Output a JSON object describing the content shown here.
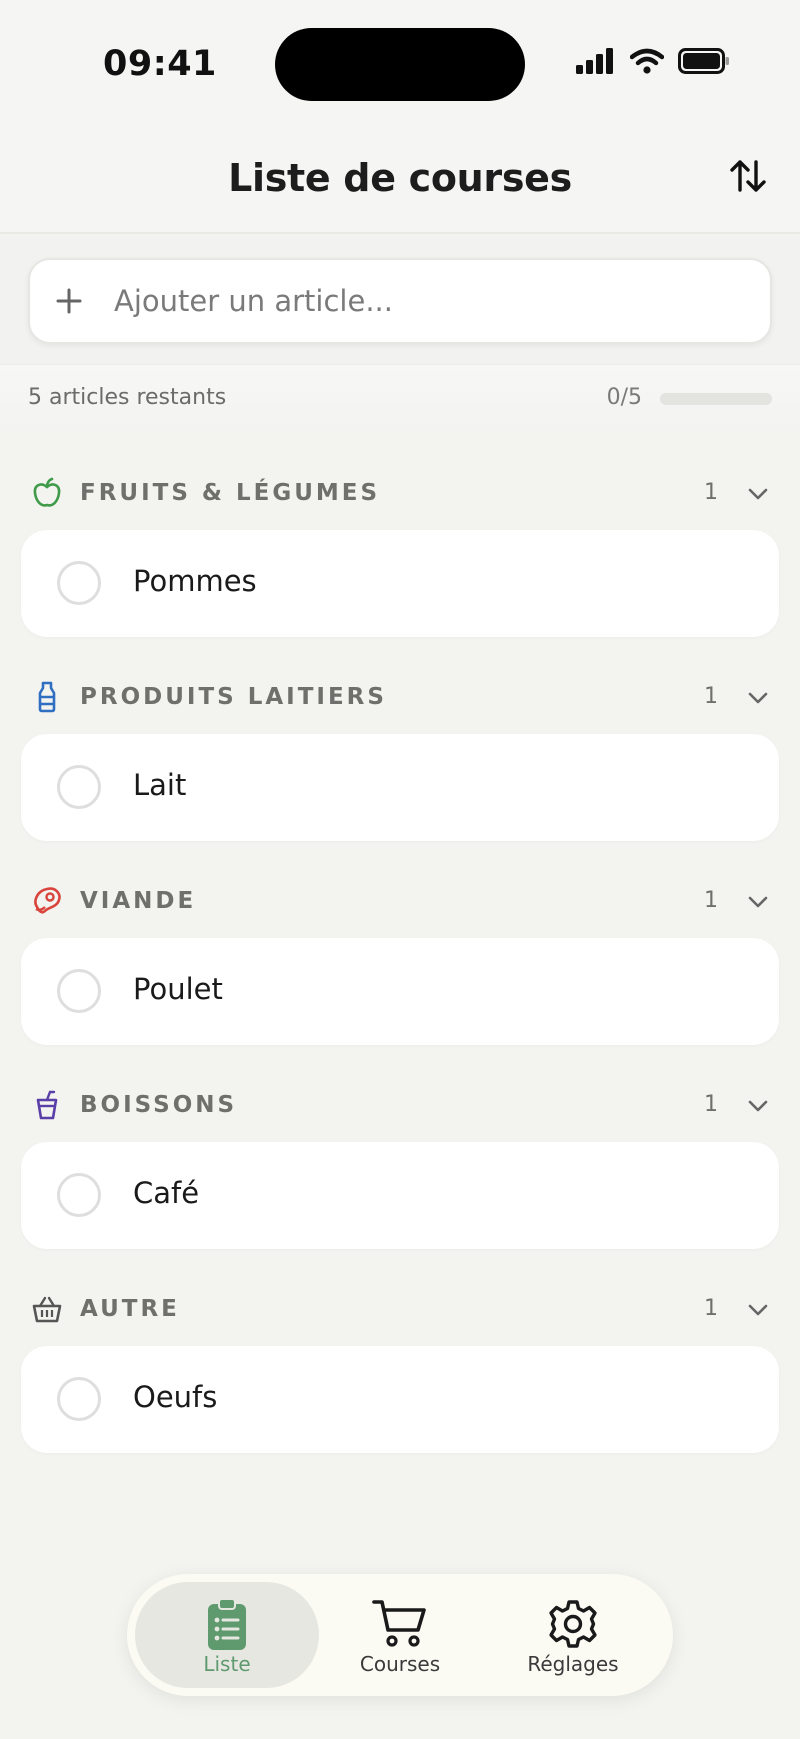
{
  "status": {
    "time": "09:41"
  },
  "header": {
    "title": "Liste de courses"
  },
  "add_input": {
    "placeholder": "Ajouter un article..."
  },
  "progress": {
    "remaining_text": "5 articles restants",
    "count_text": "0/5",
    "fraction": 0
  },
  "colors": {
    "accent": "#5f9a6f",
    "fruits": "#3f9a4a",
    "laitiers": "#2f6fc2",
    "viande": "#d9453c",
    "boissons": "#5a3fa8",
    "autre": "#555555"
  },
  "categories": [
    {
      "name": "FRUITS & LÉGUMES",
      "count": "1",
      "icon": "apple-icon",
      "items": [
        {
          "label": "Pommes",
          "checked": false
        }
      ]
    },
    {
      "name": "PRODUITS LAITIERS",
      "count": "1",
      "icon": "milk-bottle-icon",
      "items": [
        {
          "label": "Lait",
          "checked": false
        }
      ]
    },
    {
      "name": "VIANDE",
      "count": "1",
      "icon": "meat-icon",
      "items": [
        {
          "label": "Poulet",
          "checked": false
        }
      ]
    },
    {
      "name": "BOISSONS",
      "count": "1",
      "icon": "drink-cup-icon",
      "items": [
        {
          "label": "Café",
          "checked": false
        }
      ]
    },
    {
      "name": "AUTRE",
      "count": "1",
      "icon": "basket-icon",
      "items": [
        {
          "label": "Oeufs",
          "checked": false
        }
      ]
    }
  ],
  "nav": [
    {
      "label": "Liste",
      "icon": "clipboard-list-icon",
      "active": true
    },
    {
      "label": "Courses",
      "icon": "cart-icon",
      "active": false
    },
    {
      "label": "Réglages",
      "icon": "gear-icon",
      "active": false
    }
  ]
}
